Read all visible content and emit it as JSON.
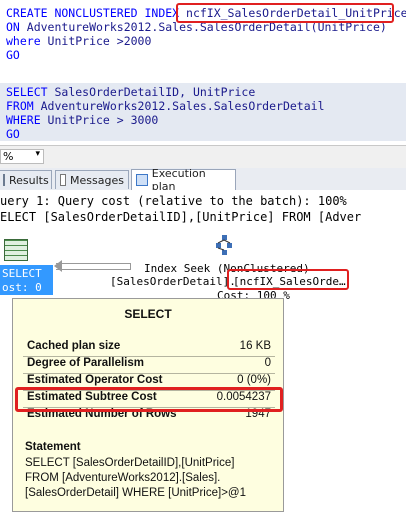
{
  "editor": {
    "lines": [
      {
        "kw": "CREATE NONCLUSTERED INDEX ",
        "rest": "ncfIX_SalesOrderDetail_UnitPrice"
      },
      {
        "kw": "ON ",
        "rest": "AdventureWorks2012.Sales.SalesOrderDetail(UnitPrice)"
      },
      {
        "kw": "where ",
        "rest": "UnitPrice >2000"
      },
      {
        "kw": "GO",
        "rest": ""
      },
      {
        "kw": "",
        "rest": ""
      },
      {
        "kw": "SELECT ",
        "rest": "SalesOrderDetailID, UnitPrice"
      },
      {
        "kw": "FROM ",
        "rest": "AdventureWorks2012.Sales.SalesOrderDetail"
      },
      {
        "kw": "WHERE ",
        "rest": "UnitPrice > 3000"
      },
      {
        "kw": "GO",
        "rest": ""
      }
    ]
  },
  "zoom": {
    "value": "%"
  },
  "tabs": [
    {
      "label": "Results",
      "icon": "grid-icon"
    },
    {
      "label": "Messages",
      "icon": "messages-icon"
    },
    {
      "label": "Execution plan",
      "icon": "plan-icon",
      "active": true
    }
  ],
  "plan": {
    "header1": "uery 1: Query cost (relative to the batch): 100%",
    "header2": "ELECT [SalesOrderDetailID],[UnitPrice] FROM [Adver",
    "select_label": "SELECT",
    "select_cost": "ost: 0 %",
    "seek_title": "Index Seek (NonClustered)",
    "seek_table": "[SalesOrderDetail].",
    "seek_index": "[ncfIX_SalesOrde…",
    "seek_cost": "Cost: 100 %"
  },
  "tooltip": {
    "title": "SELECT",
    "rows": [
      {
        "k": "Cached plan size",
        "v": "16 KB"
      },
      {
        "k": "Degree of Parallelism",
        "v": "0"
      },
      {
        "k": "Estimated Operator Cost",
        "v": "0 (0%)"
      },
      {
        "k": "Estimated Subtree Cost",
        "v": "0.0054237"
      },
      {
        "k": "Estimated Number of Rows",
        "v": "1947"
      }
    ],
    "stmt_title": "Statement",
    "stmt_lines": [
      "SELECT [SalesOrderDetailID],[UnitPrice]",
      "FROM [AdventureWorks2012].[Sales].",
      "[SalesOrderDetail] WHERE [UnitPrice]>@1"
    ]
  },
  "colors": {
    "keyword": "#0000ff",
    "identifier": "#1a1a8c",
    "highlight": "#e02020",
    "tooltip_bg": "#fefee0"
  }
}
